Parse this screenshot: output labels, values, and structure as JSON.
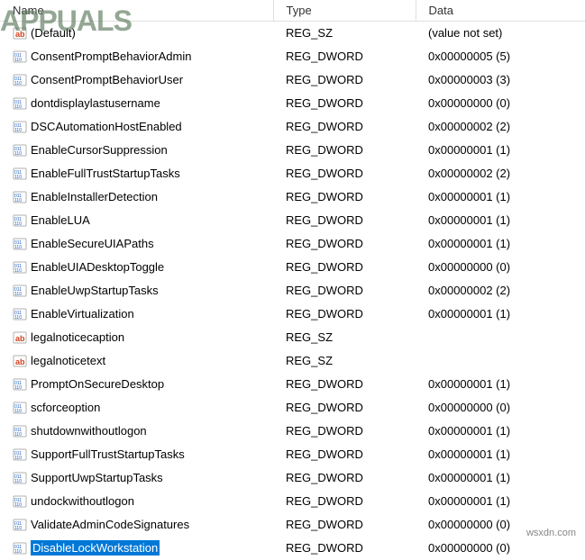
{
  "columns": {
    "name": "Name",
    "type": "Type",
    "data": "Data"
  },
  "rows": [
    {
      "icon": "sz",
      "name": "(Default)",
      "type": "REG_SZ",
      "data": "(value not set)",
      "selected": false
    },
    {
      "icon": "dword",
      "name": "ConsentPromptBehaviorAdmin",
      "type": "REG_DWORD",
      "data": "0x00000005 (5)",
      "selected": false
    },
    {
      "icon": "dword",
      "name": "ConsentPromptBehaviorUser",
      "type": "REG_DWORD",
      "data": "0x00000003 (3)",
      "selected": false
    },
    {
      "icon": "dword",
      "name": "dontdisplaylastusername",
      "type": "REG_DWORD",
      "data": "0x00000000 (0)",
      "selected": false
    },
    {
      "icon": "dword",
      "name": "DSCAutomationHostEnabled",
      "type": "REG_DWORD",
      "data": "0x00000002 (2)",
      "selected": false
    },
    {
      "icon": "dword",
      "name": "EnableCursorSuppression",
      "type": "REG_DWORD",
      "data": "0x00000001 (1)",
      "selected": false
    },
    {
      "icon": "dword",
      "name": "EnableFullTrustStartupTasks",
      "type": "REG_DWORD",
      "data": "0x00000002 (2)",
      "selected": false
    },
    {
      "icon": "dword",
      "name": "EnableInstallerDetection",
      "type": "REG_DWORD",
      "data": "0x00000001 (1)",
      "selected": false
    },
    {
      "icon": "dword",
      "name": "EnableLUA",
      "type": "REG_DWORD",
      "data": "0x00000001 (1)",
      "selected": false
    },
    {
      "icon": "dword",
      "name": "EnableSecureUIAPaths",
      "type": "REG_DWORD",
      "data": "0x00000001 (1)",
      "selected": false
    },
    {
      "icon": "dword",
      "name": "EnableUIADesktopToggle",
      "type": "REG_DWORD",
      "data": "0x00000000 (0)",
      "selected": false
    },
    {
      "icon": "dword",
      "name": "EnableUwpStartupTasks",
      "type": "REG_DWORD",
      "data": "0x00000002 (2)",
      "selected": false
    },
    {
      "icon": "dword",
      "name": "EnableVirtualization",
      "type": "REG_DWORD",
      "data": "0x00000001 (1)",
      "selected": false
    },
    {
      "icon": "sz",
      "name": "legalnoticecaption",
      "type": "REG_SZ",
      "data": "",
      "selected": false
    },
    {
      "icon": "sz",
      "name": "legalnoticetext",
      "type": "REG_SZ",
      "data": "",
      "selected": false
    },
    {
      "icon": "dword",
      "name": "PromptOnSecureDesktop",
      "type": "REG_DWORD",
      "data": "0x00000001 (1)",
      "selected": false
    },
    {
      "icon": "dword",
      "name": "scforceoption",
      "type": "REG_DWORD",
      "data": "0x00000000 (0)",
      "selected": false
    },
    {
      "icon": "dword",
      "name": "shutdownwithoutlogon",
      "type": "REG_DWORD",
      "data": "0x00000001 (1)",
      "selected": false
    },
    {
      "icon": "dword",
      "name": "SupportFullTrustStartupTasks",
      "type": "REG_DWORD",
      "data": "0x00000001 (1)",
      "selected": false
    },
    {
      "icon": "dword",
      "name": "SupportUwpStartupTasks",
      "type": "REG_DWORD",
      "data": "0x00000001 (1)",
      "selected": false
    },
    {
      "icon": "dword",
      "name": "undockwithoutlogon",
      "type": "REG_DWORD",
      "data": "0x00000001 (1)",
      "selected": false
    },
    {
      "icon": "dword",
      "name": "ValidateAdminCodeSignatures",
      "type": "REG_DWORD",
      "data": "0x00000000 (0)",
      "selected": false
    },
    {
      "icon": "dword",
      "name": "DisableLockWorkstation",
      "type": "REG_DWORD",
      "data": "0x00000000 (0)",
      "selected": true
    }
  ],
  "watermark": "APPUALS",
  "watermark_domain": "wsxdn.com",
  "icons": {
    "sz": "string-icon",
    "dword": "binary-icon"
  }
}
